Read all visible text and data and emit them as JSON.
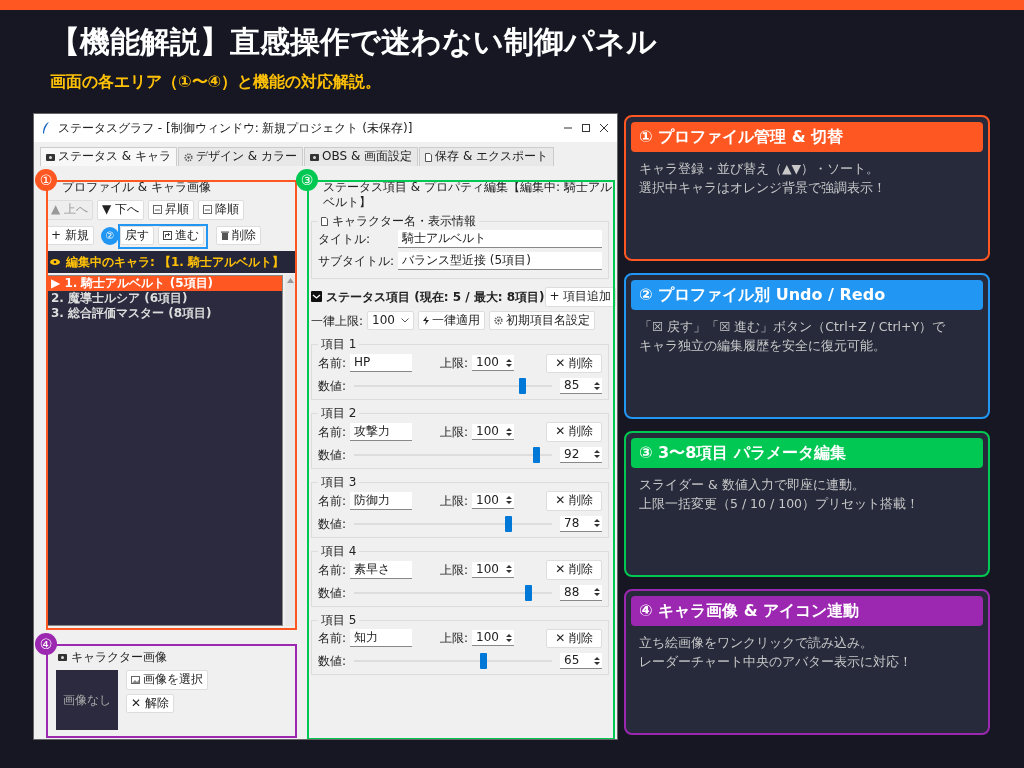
{
  "header": {
    "title": "【機能解説】直感操作で迷わない制御パネル",
    "subtitle": "画面の各エリア（①〜④）と機能の対応解説。"
  },
  "app_window": {
    "title": "ステータスグラフ - [制御ウィンドウ: 新規プロジェクト (未保存)]",
    "tabs": [
      {
        "label": "ステータス & キャラ",
        "selected": true
      },
      {
        "label": "デザイン & カラー",
        "selected": false
      },
      {
        "label": "OBS & 画面設定",
        "selected": false
      },
      {
        "label": "保存 & エクスポート",
        "selected": false
      }
    ],
    "profile_panel": {
      "title": "プロファイル & キャラ画像",
      "toolbar_rows": [
        [
          {
            "label": "▲ 上へ",
            "disabled": true
          },
          {
            "label": "▼ 下へ",
            "disabled": false
          },
          {
            "label": "昇順",
            "disabled": false
          },
          {
            "label": "降順",
            "disabled": false
          }
        ],
        [
          {
            "label": "+ 新規",
            "disabled": false
          },
          {
            "label": "戻す",
            "disabled": false
          },
          {
            "label": "進む",
            "disabled": false
          },
          {
            "label": "削除",
            "disabled": false
          }
        ]
      ],
      "editing_banner": "編集中のキャラ: 【1. 騎士アルベルト】",
      "profiles": [
        {
          "label": "▶ 1. 騎士アルベルト (5項目)",
          "selected": true
        },
        {
          "label": "2. 魔導士ルシア (6項目)",
          "selected": false
        },
        {
          "label": "3. 総合評価マスター (8項目)",
          "selected": false
        }
      ],
      "image_group": {
        "title": "キャラクター画像",
        "empty_text": "画像なし",
        "select_button": "画像を選択",
        "clear_button": "✕ 解除"
      }
    },
    "editor_panel": {
      "title": "ステータス項目 & プロパティ編集【編集中: 騎士アルベルト】",
      "info_group": {
        "title": "キャラクター名・表示情報",
        "fields": [
          {
            "label": "タイトル:",
            "value": "騎士アルベルト"
          },
          {
            "label": "サブタイトル:",
            "value": "バランス型近接 (5項目)"
          }
        ]
      },
      "items_header": "ステータス項目 (現在: 5 / 最大: 8項目)",
      "add_button": "+ 項目追加",
      "bulk": {
        "label": "一律上限:",
        "value": "100",
        "apply_button": "一律適用",
        "defaults_button": "初期項目名設定"
      },
      "items": [
        {
          "legend": "項目 1",
          "name_label": "名前:",
          "name": "HP",
          "max_label": "上限:",
          "max": "100",
          "delete_button": "✕ 削除",
          "value_label": "数値:",
          "level": 0.85,
          "value": "85"
        },
        {
          "legend": "項目 2",
          "name_label": "名前:",
          "name": "攻撃力",
          "max_label": "上限:",
          "max": "100",
          "delete_button": "✕ 削除",
          "value_label": "数値:",
          "level": 0.92,
          "value": "92"
        },
        {
          "legend": "項目 3",
          "name_label": "名前:",
          "name": "防御力",
          "max_label": "上限:",
          "max": "100",
          "delete_button": "✕ 削除",
          "value_label": "数値:",
          "level": 0.78,
          "value": "78"
        },
        {
          "legend": "項目 4",
          "name_label": "名前:",
          "name": "素早さ",
          "max_label": "上限:",
          "max": "100",
          "delete_button": "✕ 削除",
          "value_label": "数値:",
          "level": 0.88,
          "value": "88"
        },
        {
          "legend": "項目 5",
          "name_label": "名前:",
          "name": "知力",
          "max_label": "上限:",
          "max": "100",
          "delete_button": "✕ 削除",
          "value_label": "数値:",
          "level": 0.65,
          "value": "65"
        }
      ]
    },
    "markers": [
      {
        "number": "①",
        "color": "#ff5722"
      },
      {
        "number": "②",
        "color": "#2196f3"
      },
      {
        "number": "③",
        "color": "#00c853"
      },
      {
        "number": "④",
        "color": "#9c27b0"
      }
    ]
  },
  "callouts": [
    {
      "title": "① プロファイル管理 & 切替",
      "color": "#ff5722",
      "lines": [
        "キャラ登録・並び替え（▲▼）・ソート。",
        "選択中キャラはオレンジ背景で強調表示！"
      ]
    },
    {
      "title": "② プロファイル別 Undo / Redo",
      "color": "#2196f3",
      "lines": [
        "「☒ 戻す」「☒ 進む」ボタン（Ctrl+Z / Ctrl+Y）で",
        "キャラ独立の編集履歴を安全に復元可能。"
      ]
    },
    {
      "title": "③ 3〜8項目 パラメータ編集",
      "color": "#00c853",
      "lines": [
        "スライダー & 数値入力で即座に連動。",
        "上限一括変更（5 / 10 / 100）プリセット搭載！"
      ]
    },
    {
      "title": "④ キャラ画像 & アイコン連動",
      "color": "#9c27b0",
      "lines": [
        "立ち絵画像をワンクリックで読み込み。",
        "レーダーチャート中央のアバター表示に対応！"
      ]
    }
  ]
}
